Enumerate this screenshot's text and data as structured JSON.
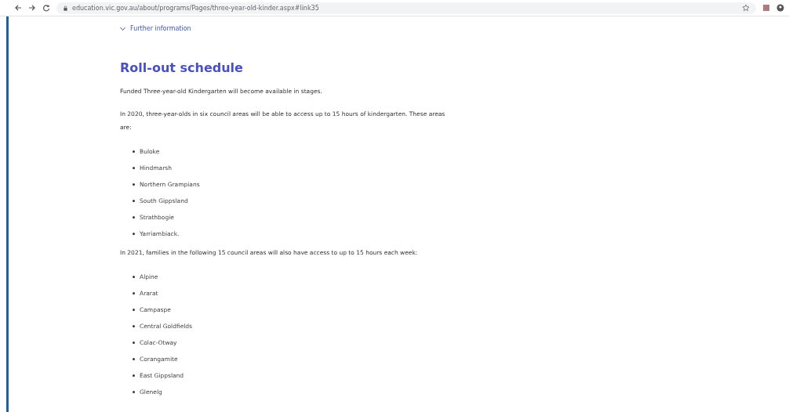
{
  "browser": {
    "url": "education.vic.gov.au/about/programs/Pages/three-year-old-kinder.aspx#link35"
  },
  "further_information": {
    "label": "Further information",
    "expanded": false
  },
  "heading": "Roll-out schedule",
  "content": [
    {
      "kind": "paragraph",
      "text": "Funded Three-year-old Kindergarten will become available in stages."
    },
    {
      "kind": "paragraph",
      "text": "In 2020, three-year-olds in six council areas will be able to access up to 15 hours of kindergarten. These areas are:"
    },
    {
      "kind": "list",
      "items": [
        "Buloke",
        "Hindmarsh",
        "Northern Grampians",
        "South Gippsland",
        "Strathbogie",
        "Yarriambiack."
      ]
    },
    {
      "kind": "paragraph",
      "text": "In 2021, families in the following 15 council areas will also have access to up to 15 hours each week:"
    },
    {
      "kind": "list",
      "items": [
        "Alpine",
        "Ararat",
        "Campaspe",
        "Central Goldfields",
        "Colac-Otway",
        "Corangamite",
        "East Gippsland",
        "Glenelg"
      ]
    }
  ]
}
